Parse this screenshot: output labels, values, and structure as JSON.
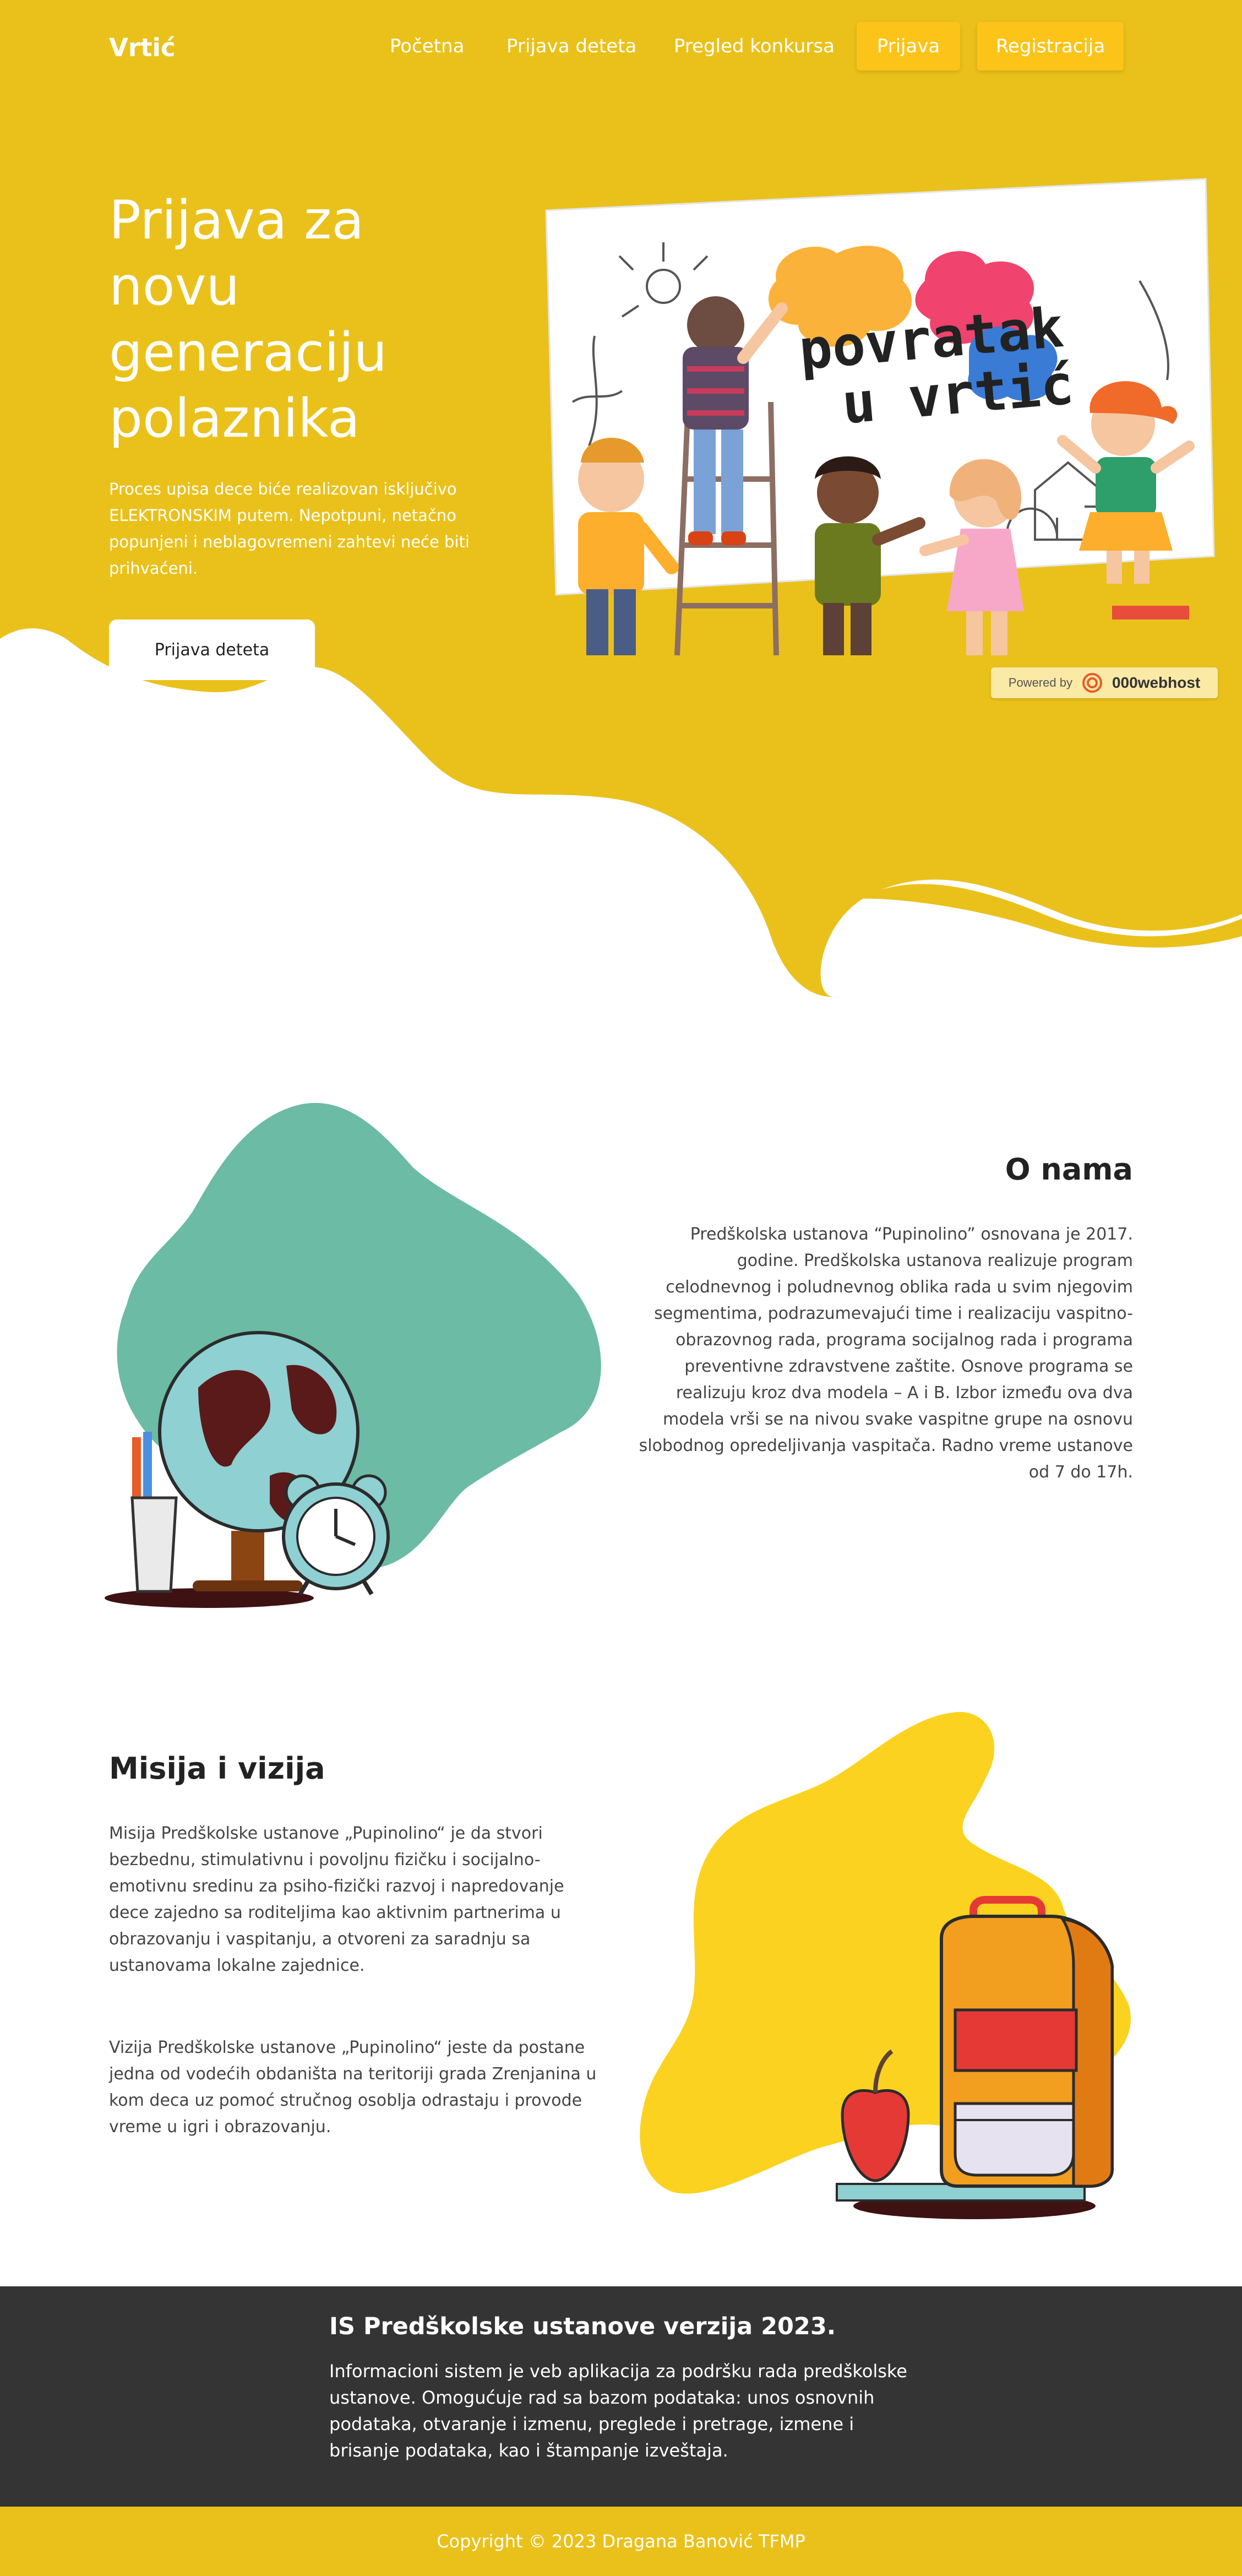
{
  "brand": "Vrtić",
  "colors": {
    "primary_yellow": "#eac11a",
    "button_yellow": "#fcc419",
    "teal_blob": "#6cbba4",
    "yellow_blob": "#fbd21f",
    "footer_dark": "#343434",
    "white": "#ffffff"
  },
  "nav": {
    "links": [
      "Početna",
      "Prijava deteta",
      "Pregled konkursa"
    ],
    "buttons": [
      "Prijava",
      "Registracija"
    ]
  },
  "hero": {
    "title": "Prijava za novu generaciju polaznika",
    "text": "Proces upisa dece biće realizovan isključivo ELEKTRONSKIM putem. Nepotpuni, netačno popunjeni i neblagovremeni zahtevi neće biti prihvaćeni.",
    "button": "Prijava deteta",
    "illustration_text_line1": "povratak",
    "illustration_text_line2": "u vrtić",
    "illustration_icon": "children-painting-illustration"
  },
  "powered_badge": {
    "prefix": "Powered by",
    "name": "000webhost",
    "icon": "000webhost-logo-icon"
  },
  "about": {
    "title": "O nama",
    "text": "Predškolska ustanova “Pupinolino” osnovana je 2017. godine. Predškolska ustanova realizuje program celodnevnog i poludnevnog oblika rada u svim njegovim segmentima, podrazumevajući time i realizaciju vaspitno-obrazovnog rada, programa socijalnog rada i programa preventivne zdravstvene zaštite. Osnove programa se realizuju kroz dva modela – A i B. Izbor između ova dva modela vrši se na nivou svake vaspitne grupe na osnovu slobodnog opredeljivanja vaspitača. Radno vreme ustanove od 7 do 17h.",
    "illustration_icon": "globe-and-alarm-clock-illustration"
  },
  "mission": {
    "title": "Misija i vizija",
    "mission_text": "Misija Predškolske ustanove „Pupinolino“ je da stvori bezbednu, stimulativnu i povoljnu fizičku i socijalno-emotivnu sredinu za psiho-fizički razvoj i napredovanje dece zajedno sa roditeljima kao aktivnim partnerima u obrazovanju i vaspitanju, a otvoreni za saradnju sa ustanovama lokalne zajednice.",
    "vision_text": "Vizija Predškolske ustanove „Pupinolino“ jeste da postane jedna od vodećih obdaništa na teritoriji grada Zrenjanina u kom deca uz pomoć stručnog osoblja odrastaju i provode vreme u igri i obrazovanju.",
    "illustration_icon": "school-backpack-and-apple-illustration"
  },
  "footer": {
    "title": "IS Predškolske ustanove verzija 2023.",
    "text": "Informacioni sistem je veb aplikacija za podršku rada predškolske ustanove. Omogućuje rad sa bazom podataka: unos osnovnih podataka, otvaranje i izmenu, preglede i pretrage, izmene i brisanje podataka, kao i štampanje izveštaja.",
    "copyright": "Copyright © 2023 Dragana Banović TFMP"
  }
}
